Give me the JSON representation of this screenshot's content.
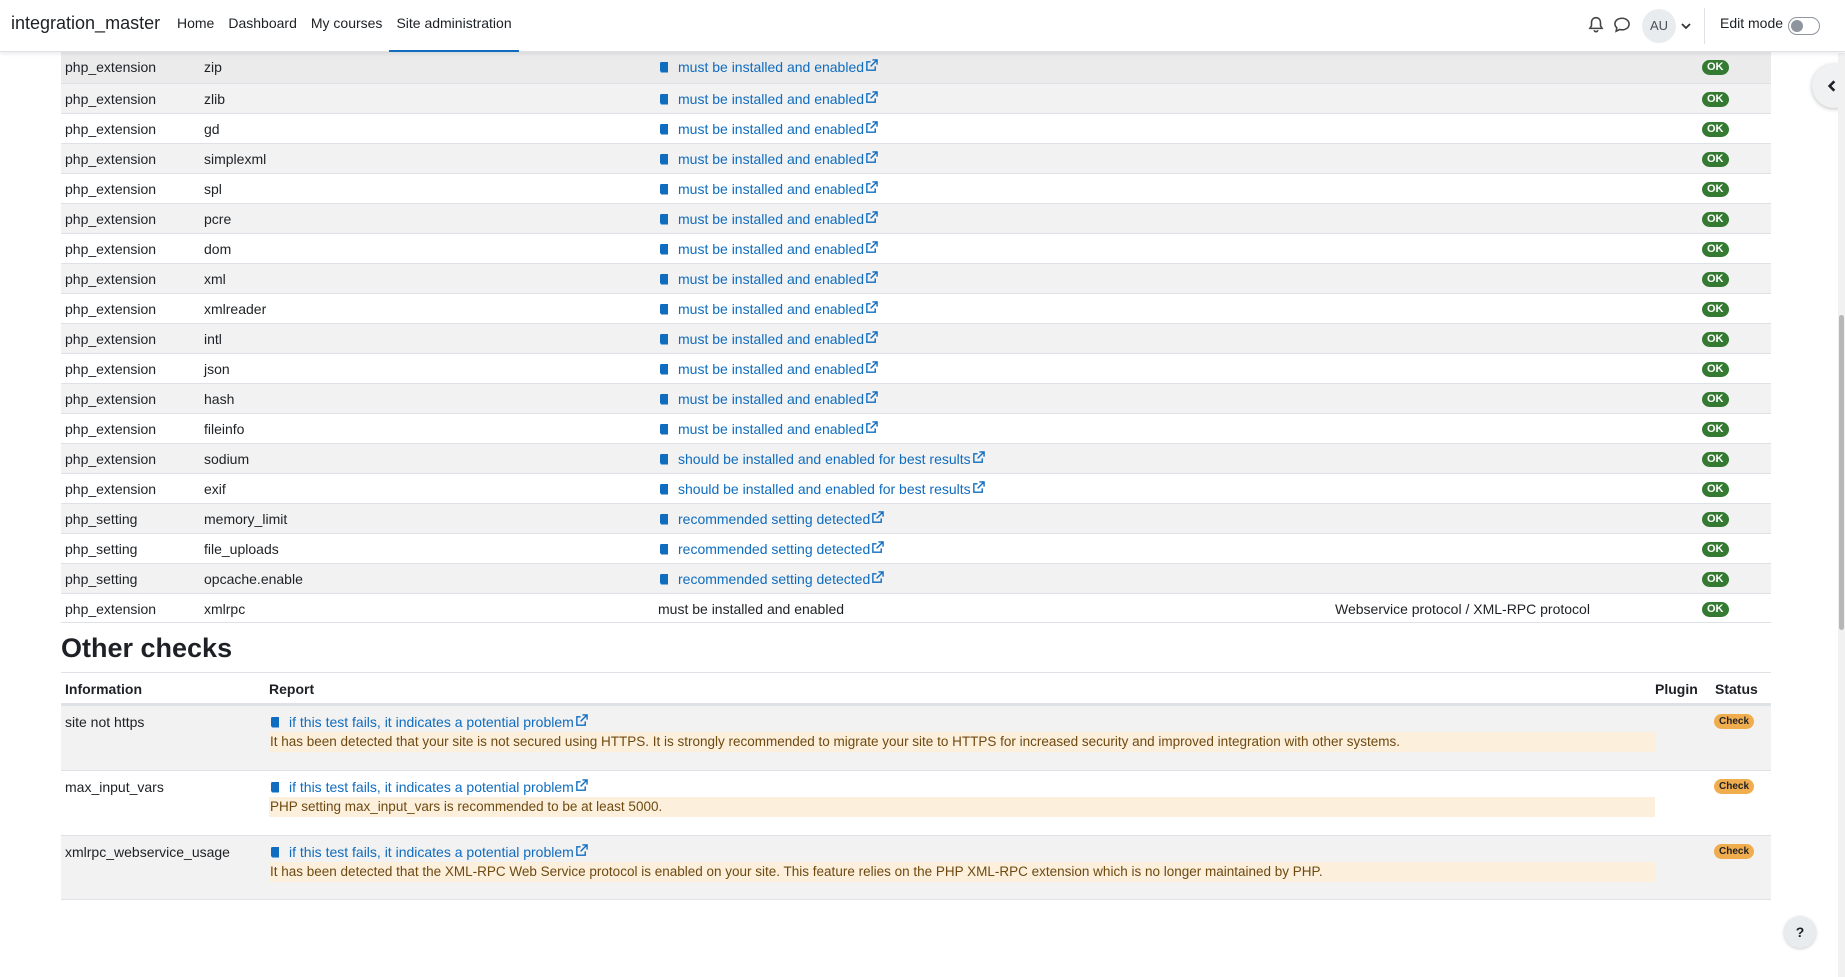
{
  "navbar": {
    "brand": "integration_master",
    "links": [
      "Home",
      "Dashboard",
      "My courses",
      "Site administration"
    ],
    "avatar_initials": "AU",
    "edit_mode_label": "Edit mode"
  },
  "env_rows": [
    {
      "type": "php_extension",
      "name": "zip",
      "report": "must be installed and enabled",
      "plugin": "",
      "status": "OK"
    },
    {
      "type": "php_extension",
      "name": "zlib",
      "report": "must be installed and enabled",
      "plugin": "",
      "status": "OK"
    },
    {
      "type": "php_extension",
      "name": "gd",
      "report": "must be installed and enabled",
      "plugin": "",
      "status": "OK"
    },
    {
      "type": "php_extension",
      "name": "simplexml",
      "report": "must be installed and enabled",
      "plugin": "",
      "status": "OK"
    },
    {
      "type": "php_extension",
      "name": "spl",
      "report": "must be installed and enabled",
      "plugin": "",
      "status": "OK"
    },
    {
      "type": "php_extension",
      "name": "pcre",
      "report": "must be installed and enabled",
      "plugin": "",
      "status": "OK"
    },
    {
      "type": "php_extension",
      "name": "dom",
      "report": "must be installed and enabled",
      "plugin": "",
      "status": "OK"
    },
    {
      "type": "php_extension",
      "name": "xml",
      "report": "must be installed and enabled",
      "plugin": "",
      "status": "OK"
    },
    {
      "type": "php_extension",
      "name": "xmlreader",
      "report": "must be installed and enabled",
      "plugin": "",
      "status": "OK"
    },
    {
      "type": "php_extension",
      "name": "intl",
      "report": "must be installed and enabled",
      "plugin": "",
      "status": "OK"
    },
    {
      "type": "php_extension",
      "name": "json",
      "report": "must be installed and enabled",
      "plugin": "",
      "status": "OK"
    },
    {
      "type": "php_extension",
      "name": "hash",
      "report": "must be installed and enabled",
      "plugin": "",
      "status": "OK"
    },
    {
      "type": "php_extension",
      "name": "fileinfo",
      "report": "must be installed and enabled",
      "plugin": "",
      "status": "OK"
    },
    {
      "type": "php_extension",
      "name": "sodium",
      "report": "should be installed and enabled for best results",
      "plugin": "",
      "status": "OK"
    },
    {
      "type": "php_extension",
      "name": "exif",
      "report": "should be installed and enabled for best results",
      "plugin": "",
      "status": "OK"
    },
    {
      "type": "php_setting",
      "name": "memory_limit",
      "report": "recommended setting detected",
      "plugin": "",
      "status": "OK"
    },
    {
      "type": "php_setting",
      "name": "file_uploads",
      "report": "recommended setting detected",
      "plugin": "",
      "status": "OK"
    },
    {
      "type": "php_setting",
      "name": "opcache.enable",
      "report": "recommended setting detected",
      "plugin": "",
      "status": "OK"
    },
    {
      "type": "php_extension",
      "name": "xmlrpc",
      "report": "must be installed and enabled",
      "plugin": "Webservice protocol / XML-RPC protocol",
      "status": "OK"
    }
  ],
  "other_checks": {
    "title": "Other checks",
    "headers": {
      "information": "Information",
      "report": "Report",
      "plugin": "Plugin",
      "status": "Status"
    },
    "rows": [
      {
        "information": "site not https",
        "link": "if this test fails, it indicates a potential problem",
        "message": "It has been detected that your site is not secured using HTTPS. It is strongly recommended to migrate your site to HTTPS for increased security and improved integration with other systems.",
        "status": "Check"
      },
      {
        "information": "max_input_vars",
        "link": "if this test fails, it indicates a potential problem",
        "message": "PHP setting max_input_vars is recommended to be at least 5000.",
        "status": "Check"
      },
      {
        "information": "xmlrpc_webservice_usage",
        "link": "if this test fails, it indicates a potential problem",
        "message": "It has been detected that the XML-RPC Web Service protocol is enabled on your site. This feature relies on the PHP XML-RPC extension which is no longer maintained by PHP.",
        "status": "Check"
      }
    ]
  },
  "help_label": "?",
  "colors": {
    "link": "#0f6cbf",
    "ok_badge": "#357a32",
    "check_badge": "#f0ad4e",
    "warning_bg": "#fcefdc"
  }
}
